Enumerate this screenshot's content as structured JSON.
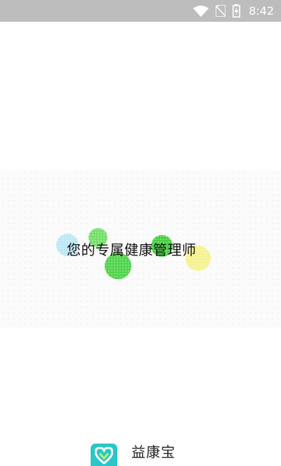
{
  "status_bar": {
    "time": "8:42",
    "icons": [
      "wifi-icon",
      "no-sim-icon",
      "battery-charging-icon"
    ]
  },
  "splash": {
    "tagline": "您的专属健康管理师"
  },
  "brand": {
    "app_name": "益康宝",
    "subtitle": "",
    "logo_icon": "heart-logo-icon",
    "logo_color": "#2bc6c7"
  },
  "colors": {
    "status_bar": "#bdbdbd",
    "dot_cyan": "#bde8f4",
    "dot_green": "#4fd44b",
    "dot_yellow": "#f5f28f"
  }
}
